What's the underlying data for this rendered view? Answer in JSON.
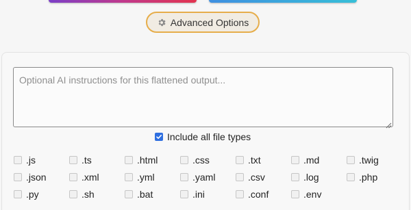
{
  "advanced_options": {
    "label": "Advanced Options",
    "icon": "gear-icon"
  },
  "instructions": {
    "placeholder": "Optional AI instructions for this flattened output...",
    "value": ""
  },
  "include_all": {
    "label": "Include all file types",
    "checked": true
  },
  "file_types": [
    ".js",
    ".ts",
    ".html",
    ".css",
    ".txt",
    ".md",
    ".twig",
    ".json",
    ".xml",
    ".yml",
    ".yaml",
    ".csv",
    ".log",
    ".php",
    ".py",
    ".sh",
    ".bat",
    ".ini",
    ".conf",
    ".env"
  ],
  "colors": {
    "accent": "#2f6fe0",
    "advanced_border": "#e6ad4a"
  }
}
